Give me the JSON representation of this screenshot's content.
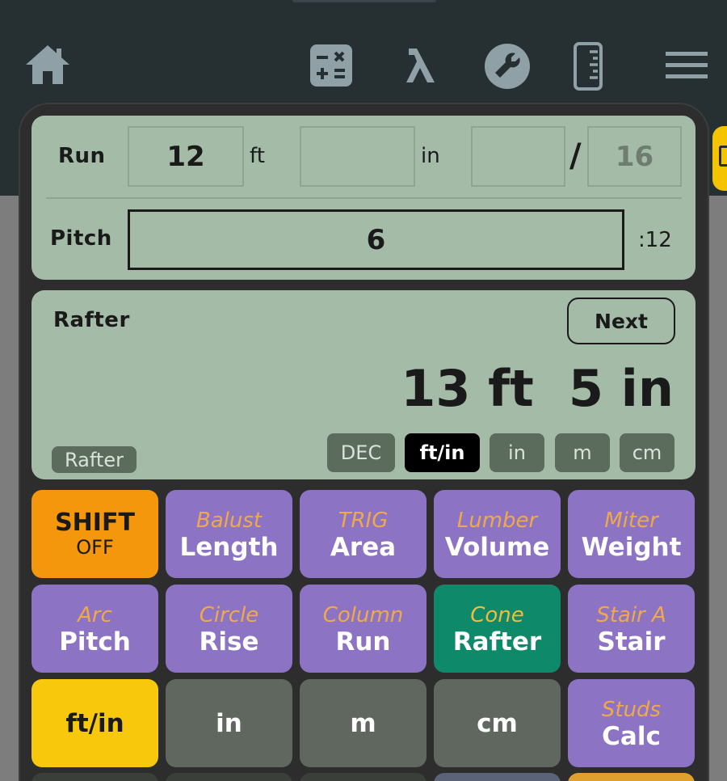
{
  "nav": {
    "icons": [
      "home-icon",
      "calculator-icon",
      "lambda-icon",
      "wrench-icon",
      "ruler-icon",
      "menu-icon"
    ]
  },
  "inputs": {
    "run_label": "Run",
    "run_ft": "12",
    "ft_unit": "ft",
    "run_in": "",
    "in_unit": "in",
    "run_frac_num": "",
    "frac_slash": "/",
    "run_frac_den": "16",
    "pitch_label": "Pitch",
    "pitch_value": "6",
    "pitch_unit": ":12"
  },
  "display": {
    "title": "Rafter",
    "next_label": "Next",
    "result": "13 ft  5 in",
    "badge": "Rafter",
    "formats": [
      "DEC",
      "ft/in",
      "in",
      "m",
      "cm"
    ],
    "selected_format": "ft/in"
  },
  "keypad": [
    {
      "sub": "",
      "main": "SHIFT",
      "main2": "OFF",
      "color": "orange"
    },
    {
      "sub": "Balust",
      "main": "Length",
      "color": "purple"
    },
    {
      "sub": "TRIG",
      "main": "Area",
      "color": "purple"
    },
    {
      "sub": "Lumber",
      "main": "Volume",
      "color": "purple"
    },
    {
      "sub": "Miter",
      "main": "Weight",
      "color": "purple"
    },
    {
      "sub": "Arc",
      "main": "Pitch",
      "color": "purple"
    },
    {
      "sub": "Circle",
      "main": "Rise",
      "color": "purple"
    },
    {
      "sub": "Column",
      "main": "Run",
      "color": "purple"
    },
    {
      "sub": "Cone",
      "main": "Rafter",
      "color": "green"
    },
    {
      "sub": "Stair A",
      "main": "Stair",
      "color": "purple"
    },
    {
      "sub": "",
      "main": "ft/in",
      "color": "yellow"
    },
    {
      "sub": "",
      "main": "in",
      "color": "gray"
    },
    {
      "sub": "",
      "main": "m",
      "color": "gray"
    },
    {
      "sub": "",
      "main": "cm",
      "color": "gray"
    },
    {
      "sub": "Studs",
      "main": "Calc",
      "color": "purple"
    }
  ],
  "colors": {
    "lcd": "#a3bba7",
    "purple_key": "#8d73c4",
    "green_key": "#0e8a6b",
    "gray_key": "#5f675f",
    "shift_key": "#f5970c",
    "unit_key": "#f7c80c",
    "secondary_label": "#f0a94a"
  }
}
